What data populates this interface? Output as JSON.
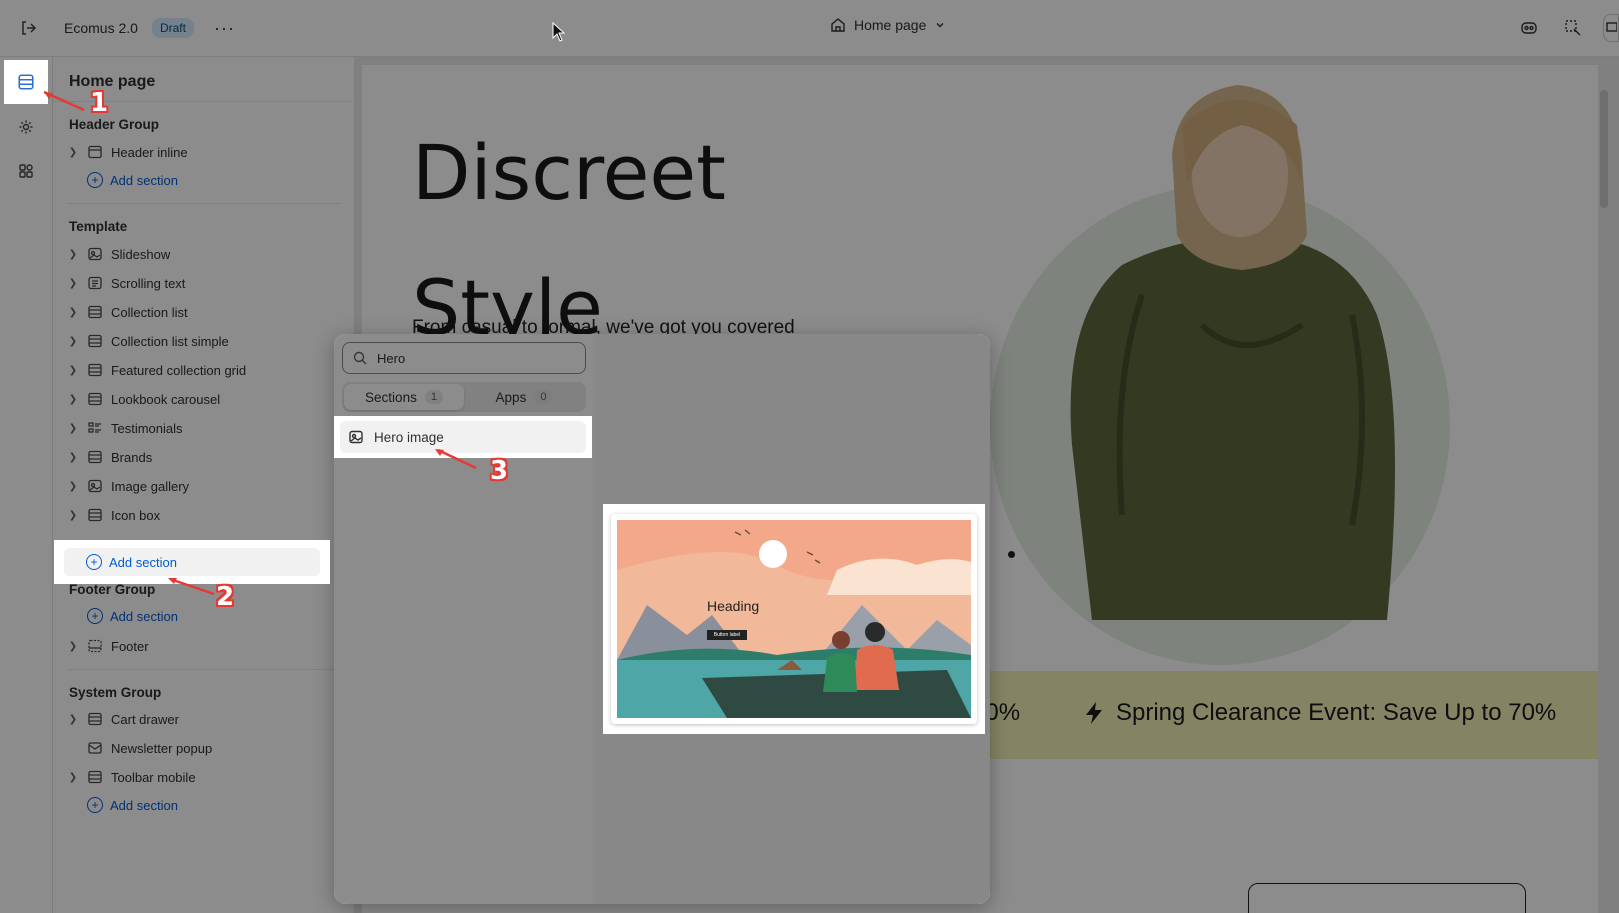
{
  "topbar": {
    "app_name": "Ecomus 2.0",
    "status_badge": "Draft",
    "more_label": "···",
    "page_name": "Home page"
  },
  "sidebar": {
    "title": "Home page",
    "groups": [
      {
        "title": "Header Group",
        "items": [
          "Header inline"
        ],
        "add_label": "Add section"
      },
      {
        "title": "Template",
        "items": [
          "Slideshow",
          "Scrolling text",
          "Collection list",
          "Collection list simple",
          "Featured collection grid",
          "Lookbook carousel",
          "Testimonials",
          "Brands",
          "Image gallery",
          "Icon box"
        ],
        "add_label": "Add section"
      },
      {
        "title": "Footer Group",
        "items": [
          "Footer"
        ],
        "add_label": "Add section"
      },
      {
        "title": "System Group",
        "items": [
          "Cart drawer",
          "Newsletter popup",
          "Toolbar mobile"
        ],
        "add_label": "Add section"
      }
    ]
  },
  "picker": {
    "search_value": "Hero",
    "tabs": [
      {
        "label": "Sections",
        "count": "1"
      },
      {
        "label": "Apps",
        "count": "0"
      }
    ],
    "result": "Hero image",
    "thumbnail": {
      "heading": "Heading",
      "button": "Button label"
    }
  },
  "preview": {
    "hero_title_line1": "Discreet",
    "hero_title_line2": "Style",
    "hero_subtitle": "From casual to formal, we've got you covered",
    "marquee_fragment": "70%",
    "marquee_text": "Spring Clearance Event: Save Up to 70%"
  },
  "annotations": [
    "1",
    "2",
    "3"
  ],
  "colors": {
    "accent": "#005bd3",
    "annotation": "#e53935",
    "marquee_bg": "#f0f0b8",
    "draft_badge": "#d5ebff"
  }
}
